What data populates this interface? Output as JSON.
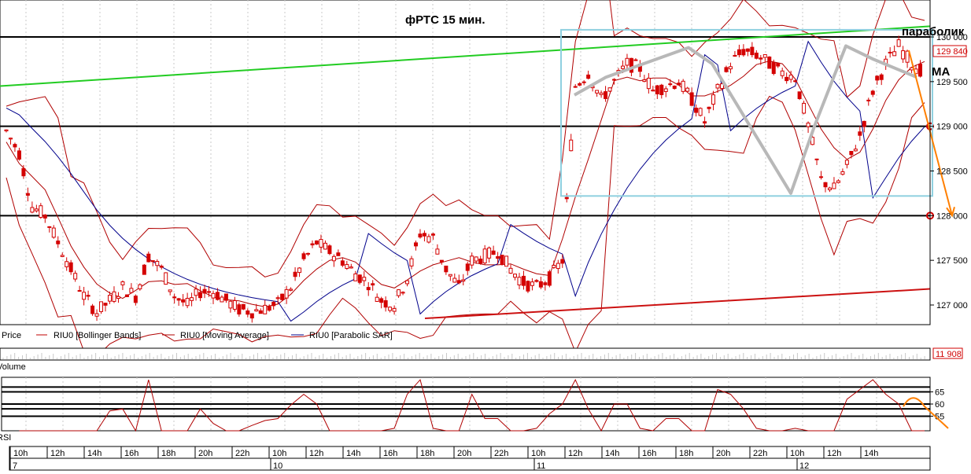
{
  "chart_data": {
    "type": "candlestick",
    "title": "фРТС   15 мин.",
    "instrument": "RIU0",
    "y_axis": {
      "range": [
        126800,
        130300
      ],
      "ticks": [
        127000,
        127500,
        128000,
        128500,
        129000,
        129500,
        130000
      ],
      "tick_labels": [
        "127 000",
        "127 500",
        "128 000",
        "128 500",
        "129 000",
        "129 500",
        "130 000"
      ],
      "last_price_label": "129 840",
      "last_price": 129840
    },
    "x_axis": {
      "hour_labels": [
        "10h",
        "12h",
        "14h",
        "16h",
        "18h",
        "20h",
        "22h",
        "10h",
        "12h",
        "14h",
        "16h",
        "18h",
        "20h",
        "22h",
        "10h",
        "12h",
        "14h",
        "16h",
        "18h",
        "20h",
        "22h",
        "10h",
        "12h",
        "14h"
      ],
      "day_labels": [
        "7",
        "10",
        "11",
        "12"
      ]
    },
    "legend": [
      {
        "name": "Price",
        "color": "#c00000"
      },
      {
        "name": "RIU0 [Bollinger Bands]",
        "color": "#b00000"
      },
      {
        "name": "RIU0 [Moving Average]",
        "color": "#b00000"
      },
      {
        "name": "RIU0 [Parabolic SAR]",
        "color": "#00008b"
      }
    ],
    "horizontal_levels": [
      130000,
      129000,
      128000
    ],
    "marked_levels": [
      129000,
      128000
    ],
    "price_series": [
      128950,
      128700,
      128100,
      128000,
      127700,
      127400,
      127100,
      126920,
      127050,
      127200,
      127100,
      127550,
      127400,
      127100,
      127000,
      127150,
      127150,
      127050,
      126950,
      126930,
      126960,
      127010,
      127200,
      127500,
      127700,
      127600,
      127500,
      127350,
      127250,
      127050,
      127000,
      127300,
      127800,
      127750,
      127400,
      127200,
      127500,
      127550,
      127600,
      127400,
      127250,
      127200,
      127300,
      127500,
      129450,
      129600,
      129300,
      129500,
      129700,
      129650,
      129400,
      129450,
      129500,
      129300,
      129050,
      129400,
      129700,
      129850,
      129800,
      129700,
      129600,
      129550,
      129000,
      128400,
      128300,
      128550,
      128900,
      129400,
      129700,
      129900,
      129700,
      129600
    ],
    "volume_panel": {
      "label": "Volume",
      "last_value_label": "11 908",
      "last_value": 11908
    },
    "rsi_panel": {
      "label": "RSI",
      "ticks": [
        55,
        60,
        65
      ],
      "tick_labels": [
        "55",
        "60",
        "65"
      ]
    },
    "annotations": {
      "parabolic_label": "параболик",
      "ma_label": "МА"
    },
    "colors": {
      "candle": "#d40000",
      "bollinger": "#b00000",
      "sar": "#00008b",
      "green_trend": "#22cc22",
      "red_trend": "#cc1111",
      "range_box": "#8fd0e0",
      "pattern": "#b8b8b8",
      "forecast": "#ff7f00"
    }
  }
}
